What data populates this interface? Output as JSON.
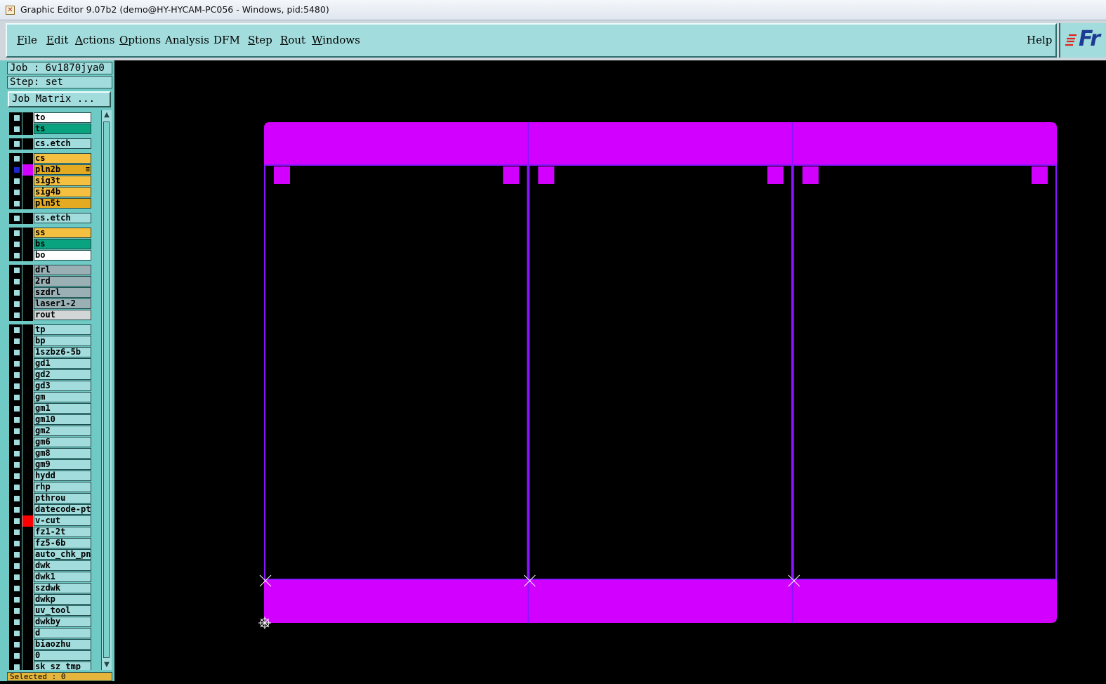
{
  "window": {
    "title": "Graphic Editor 9.07b2 (demo@HY-HYCAM-PC056 - Windows, pid:5480)"
  },
  "menu": {
    "items": [
      {
        "label": "File",
        "underline": true
      },
      {
        "label": "Edit",
        "underline": true
      },
      {
        "label": "Actions",
        "underline": true
      },
      {
        "label": "Options",
        "underline": true
      },
      {
        "label": "Analysis",
        "underline": false
      },
      {
        "label": "DFM",
        "underline": false
      },
      {
        "label": "Step",
        "underline": true
      },
      {
        "label": "Rout",
        "underline": true
      },
      {
        "label": "Windows",
        "underline": true
      }
    ],
    "help": "Help"
  },
  "brand": {
    "logo_text": "Fr"
  },
  "job": {
    "label": "Job : 6v1870jya0",
    "step": "Step: set"
  },
  "job_matrix_button": "Job Matrix ...",
  "layers": [
    {
      "name": "to",
      "color": "#ffffff"
    },
    {
      "name": "ts",
      "color": "#0aa37f"
    },
    {
      "name": "cs.etch",
      "color": "#a2dcdc"
    },
    {
      "name": "cs",
      "color": "#f5c040"
    },
    {
      "name": "pln2b",
      "color": "#e3aa22",
      "checked": true,
      "display_color": "#d200ff",
      "marker": true
    },
    {
      "name": "sig3t",
      "color": "#f5c040"
    },
    {
      "name": "sig4b",
      "color": "#f5c040"
    },
    {
      "name": "pln5t",
      "color": "#e3aa22"
    },
    {
      "name": "ss.etch",
      "color": "#a2dcdc"
    },
    {
      "name": "ss",
      "color": "#f5c040"
    },
    {
      "name": "bs",
      "color": "#0aa37f"
    },
    {
      "name": "bo",
      "color": "#ffffff"
    },
    {
      "name": "drl",
      "color": "#9bb0b5"
    },
    {
      "name": "2rd",
      "color": "#9bb0b5"
    },
    {
      "name": "szdrl",
      "color": "#9bb0b5"
    },
    {
      "name": "laser1-2",
      "color": "#9bb0b5"
    },
    {
      "name": "rout",
      "color": "#d3d6d6"
    },
    {
      "name": "tp",
      "color": "#a2dcdc"
    },
    {
      "name": "bp",
      "color": "#a2dcdc"
    },
    {
      "name": "1szbz6-5b",
      "color": "#a2dcdc"
    },
    {
      "name": "gd1",
      "color": "#a2dcdc"
    },
    {
      "name": "gd2",
      "color": "#a2dcdc"
    },
    {
      "name": "gd3",
      "color": "#a2dcdc"
    },
    {
      "name": "gm",
      "color": "#a2dcdc"
    },
    {
      "name": "gm1",
      "color": "#a2dcdc"
    },
    {
      "name": "gm10",
      "color": "#a2dcdc"
    },
    {
      "name": "gm2",
      "color": "#a2dcdc"
    },
    {
      "name": "gm6",
      "color": "#a2dcdc"
    },
    {
      "name": "gm8",
      "color": "#a2dcdc"
    },
    {
      "name": "gm9",
      "color": "#a2dcdc"
    },
    {
      "name": "hydd",
      "color": "#a2dcdc"
    },
    {
      "name": "rhp",
      "color": "#a2dcdc"
    },
    {
      "name": "pthrou",
      "color": "#a2dcdc"
    },
    {
      "name": "datecode-pt",
      "color": "#a2dcdc"
    },
    {
      "name": "v-cut",
      "color": "#a2dcdc",
      "display_color": "#ff0000"
    },
    {
      "name": "fz1-2t",
      "color": "#a2dcdc"
    },
    {
      "name": "fz5-6b",
      "color": "#a2dcdc"
    },
    {
      "name": "auto_chk_pnl",
      "color": "#a2dcdc"
    },
    {
      "name": "dwk",
      "color": "#a2dcdc"
    },
    {
      "name": "dwk1",
      "color": "#a2dcdc"
    },
    {
      "name": "szdwk",
      "color": "#a2dcdc"
    },
    {
      "name": "dwkp",
      "color": "#a2dcdc"
    },
    {
      "name": "uv_tool",
      "color": "#a2dcdc"
    },
    {
      "name": "dwkby",
      "color": "#a2dcdc"
    },
    {
      "name": "d",
      "color": "#a2dcdc"
    },
    {
      "name": "biaozhu",
      "color": "#a2dcdc"
    },
    {
      "name": "0",
      "color": "#a2dcdc"
    },
    {
      "name": "sk_sz_tmp",
      "color": "#a2dcdc"
    }
  ],
  "selected": "Selected : 0",
  "colors": {
    "panel": "#a2dcdc",
    "board_fill": "#d200ff",
    "outline": "#8a14ff",
    "canvas": "#000000"
  },
  "canvas": {
    "panels": 3,
    "layer": "pln2b"
  }
}
